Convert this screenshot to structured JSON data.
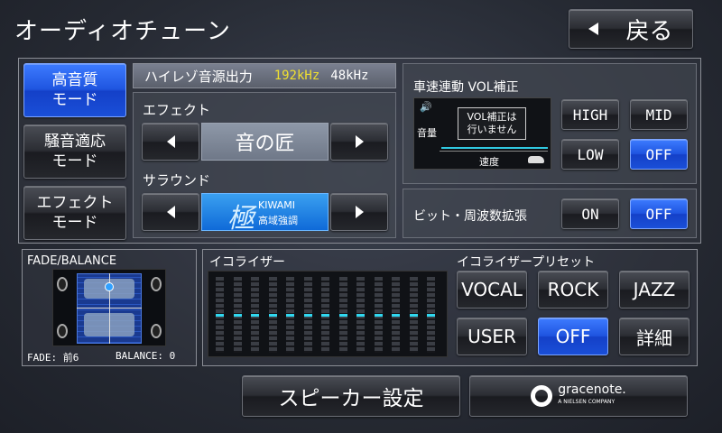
{
  "header": {
    "title": "オーディオチューン",
    "back_label": "戻る"
  },
  "modes": [
    {
      "label_line1": "高音質",
      "label_line2": "モード",
      "active": true
    },
    {
      "label_line1": "騒音適応",
      "label_line2": "モード",
      "active": false
    },
    {
      "label_line1": "エフェクト",
      "label_line2": "モード",
      "active": false
    }
  ],
  "hires": {
    "label": "ハイレゾ音源出力",
    "value_selected": "192kHz",
    "value_other": "48kHz",
    "accent": "#f0e030"
  },
  "effect": {
    "label": "エフェクト",
    "value": "音の匠"
  },
  "surround": {
    "label": "サラウンド",
    "logo_char": "極",
    "logo_name": "KIWAMI",
    "logo_sub": "高域強調"
  },
  "speed_vol": {
    "label": "車速連動 VOL補正",
    "graph_message_line1": "VOL補正は",
    "graph_message_line2": "行いません",
    "axis_y": "音量",
    "axis_x": "速度",
    "buttons": [
      {
        "label": "HIGH",
        "active": false
      },
      {
        "label": "MID",
        "active": false
      },
      {
        "label": "LOW",
        "active": false
      },
      {
        "label": "OFF",
        "active": true
      }
    ]
  },
  "bit_ext": {
    "label": "ビット・周波数拡張",
    "buttons": [
      {
        "label": "ON",
        "active": false
      },
      {
        "label": "OFF",
        "active": true
      }
    ]
  },
  "fade_balance": {
    "title": "FADE/BALANCE",
    "fade_text": "FADE: 前6",
    "balance_text": "BALANCE: 0"
  },
  "equalizer": {
    "title": "イコライザー",
    "levels": [
      0.5,
      0.5,
      0.5,
      0.5,
      0.5,
      0.5,
      0.5,
      0.5,
      0.5,
      0.5,
      0.5,
      0.5,
      0.5
    ]
  },
  "eq_preset": {
    "title": "イコライザープリセット",
    "buttons": [
      {
        "label": "VOCAL",
        "active": false
      },
      {
        "label": "ROCK",
        "active": false
      },
      {
        "label": "JAZZ",
        "active": false
      },
      {
        "label": "USER",
        "active": false
      },
      {
        "label": "OFF",
        "active": true
      },
      {
        "label": "詳細",
        "active": false
      }
    ]
  },
  "footer": {
    "speaker_label": "スピーカー設定",
    "gracenote_name": "gracenote.",
    "gracenote_sub": "A NIELSEN COMPANY"
  }
}
